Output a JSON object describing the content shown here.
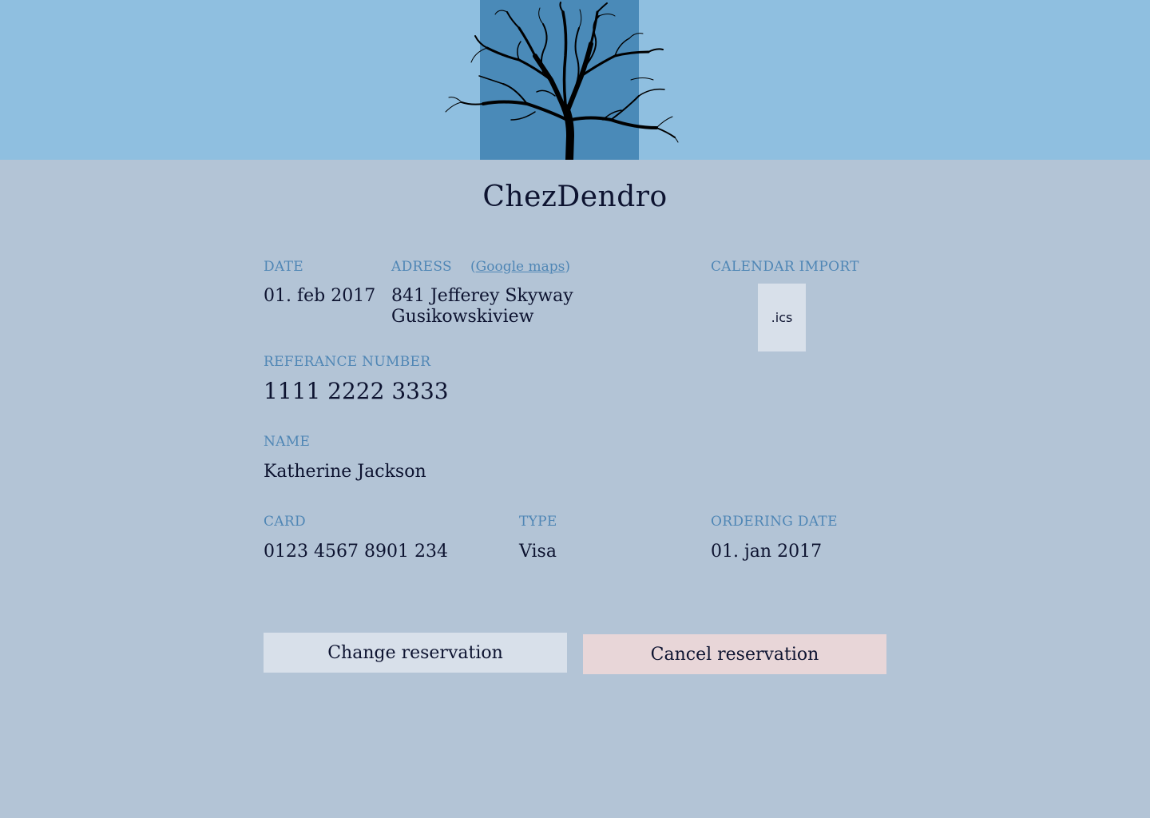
{
  "brand": {
    "name": "ChezDendro",
    "logo_icon": "tree-icon"
  },
  "colors": {
    "header_bg": "#8fbfe0",
    "logo_tile": "#4a8ab8",
    "page_bg": "#b3c4d6",
    "label": "#4f86b5",
    "text": "#0d1330",
    "change_button_bg": "#d8e0ea",
    "cancel_button_bg": "#e8d6d8"
  },
  "reservation": {
    "date_label": "DATE",
    "date_value": "01. feb 2017",
    "address_label": "ADRESS",
    "maps_open": "(",
    "maps_link": "Google maps",
    "maps_close": ")",
    "address_line1": "841 Jefferey Skyway",
    "address_line2": "Gusikowskiview",
    "calendar_label": "CALENDAR IMPORT",
    "ics_label": ".ics",
    "reference_label": "REFERANCE NUMBER",
    "reference_value": "1111 2222 3333",
    "name_label": "NAME",
    "name_value": "Katherine Jackson",
    "card_label": "CARD",
    "card_value": "0123 4567 8901 234",
    "type_label": "TYPE",
    "type_value": "Visa",
    "ordering_date_label": "ORDERING DATE",
    "ordering_date_value": "01. jan 2017"
  },
  "actions": {
    "change_label": "Change reservation",
    "cancel_label": "Cancel reservation"
  }
}
